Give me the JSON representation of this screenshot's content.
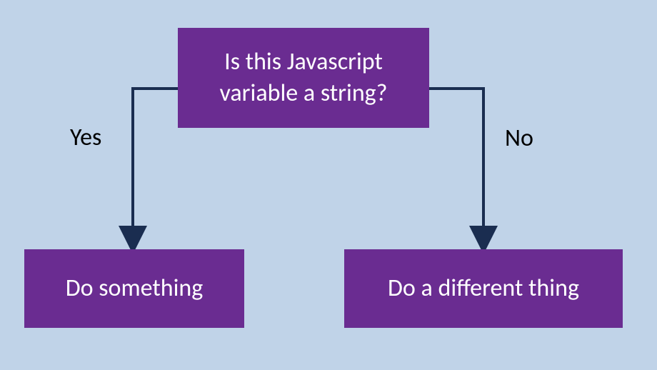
{
  "flowchart": {
    "decision": "Is this Javascript variable a string?",
    "yes_label": "Yes",
    "no_label": "No",
    "yes_action": "Do something",
    "no_action": "Do a different thing"
  },
  "colors": {
    "background": "#c0d3e8",
    "box_fill": "#6a2c91",
    "box_text": "#ffffff",
    "connector": "#1a2d50",
    "label_text": "#000000"
  }
}
